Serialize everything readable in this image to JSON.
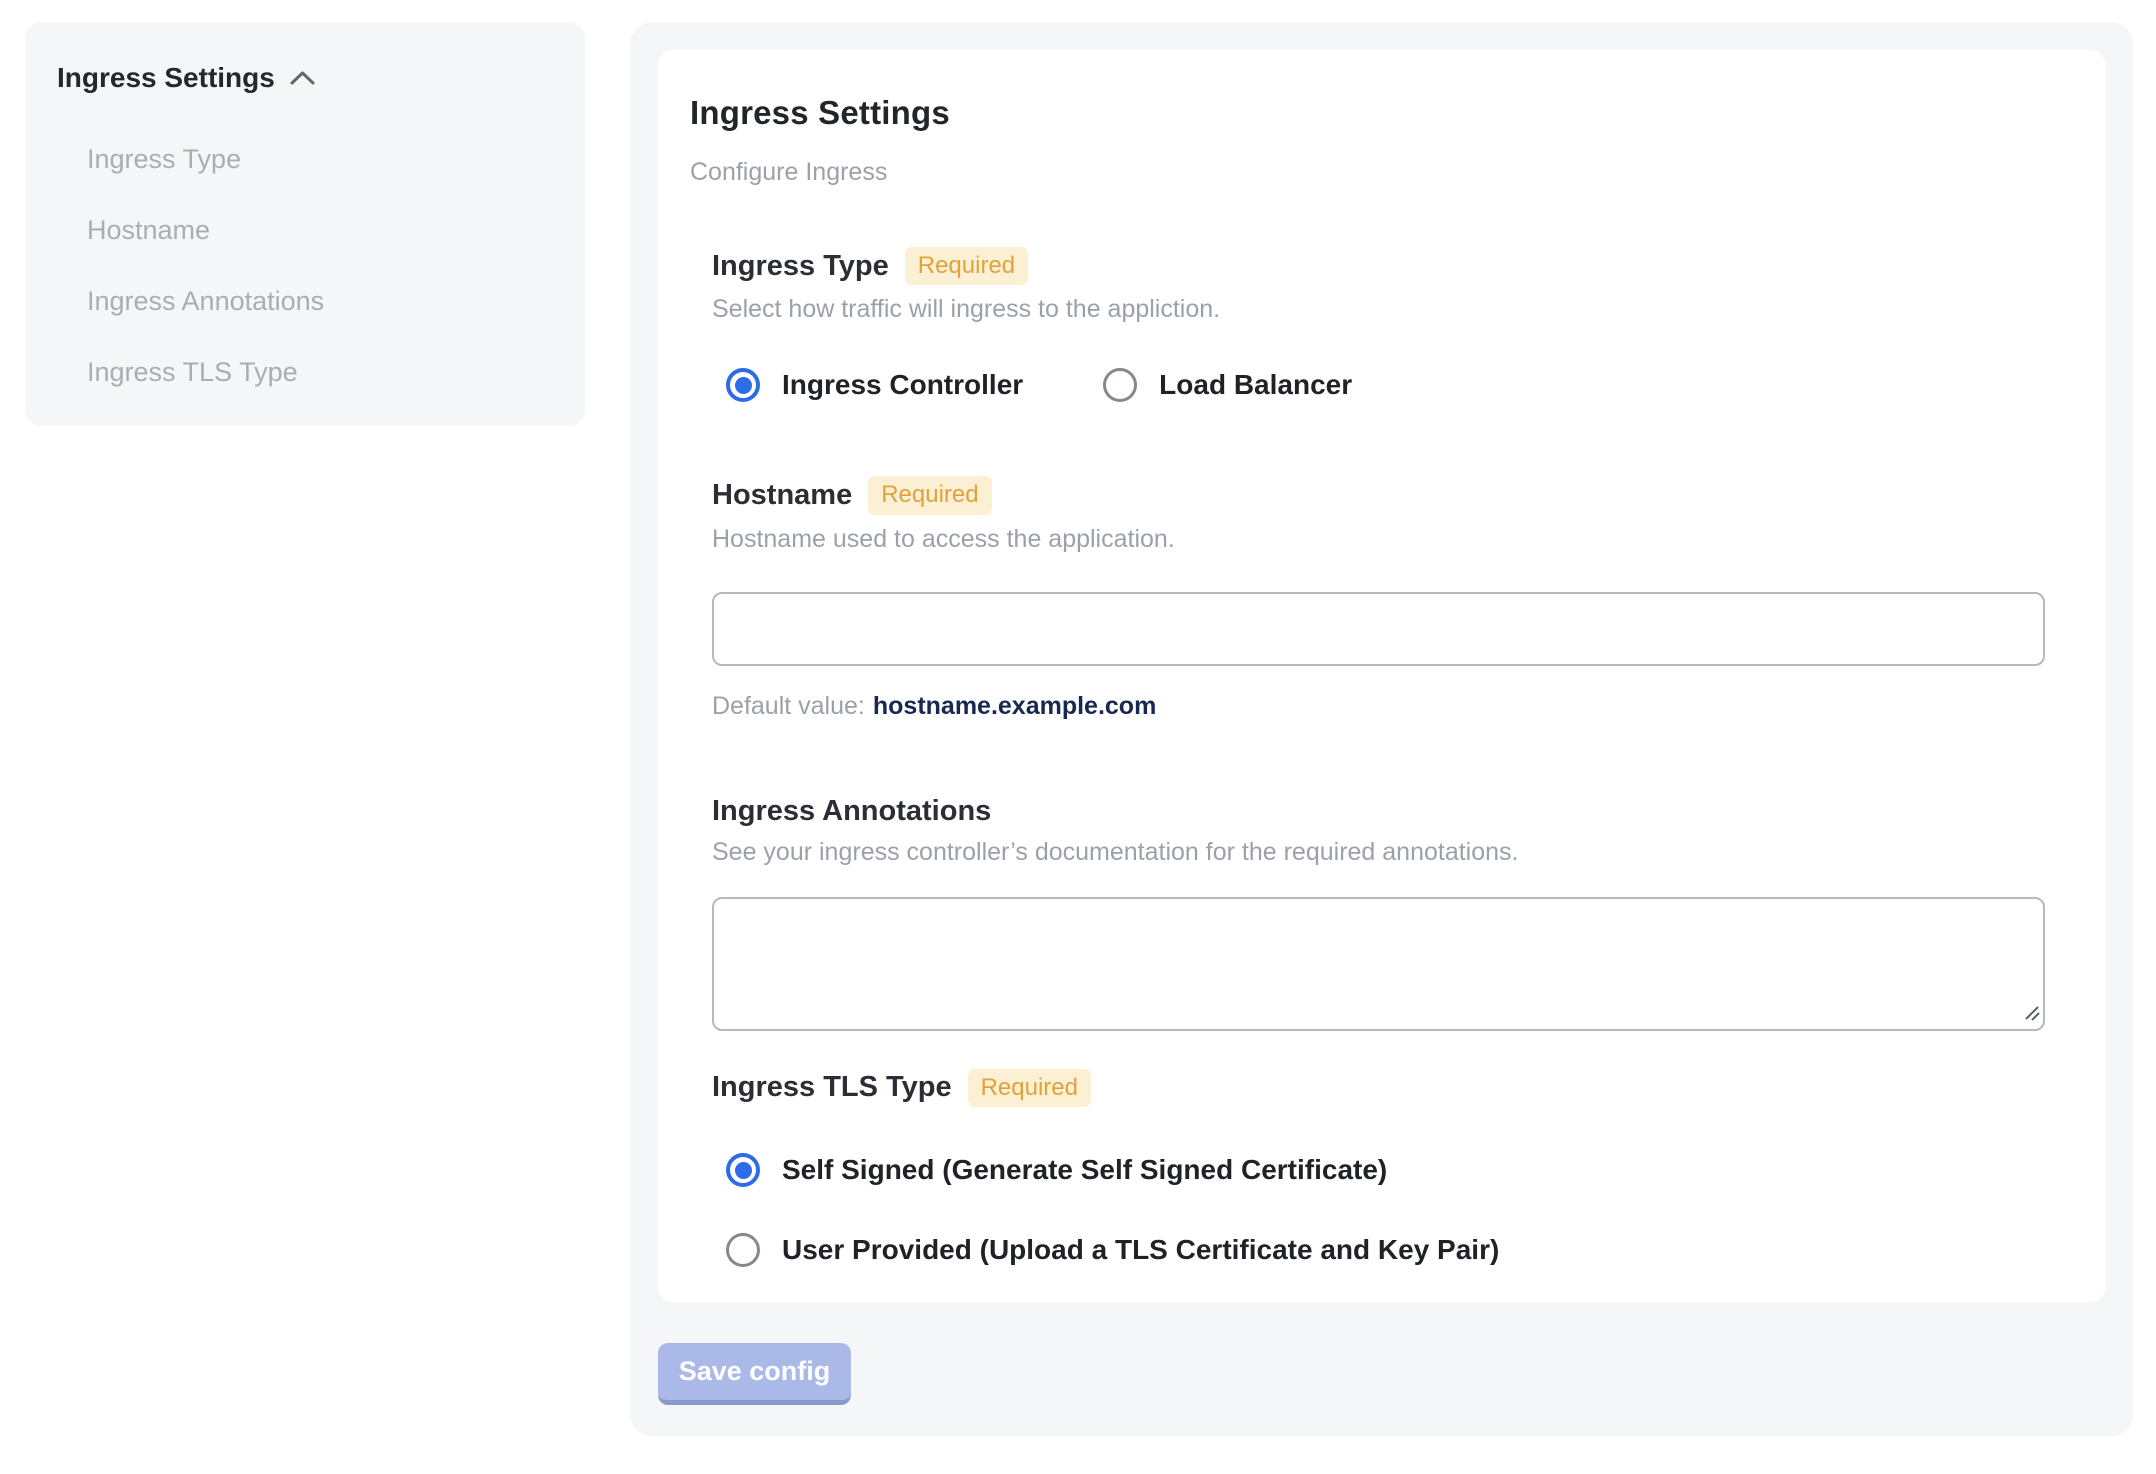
{
  "colors": {
    "panel_bg": "#f5f6f8",
    "accent_blue": "#2c6ce8",
    "badge_bg": "#fbf0d3",
    "badge_text": "#e2a23b",
    "save_button_bg": "#abb9e9",
    "default_value_text": "#182851"
  },
  "sidebar": {
    "header": "Ingress Settings",
    "collapse_icon": "chevron-up-icon",
    "items": [
      {
        "label": "Ingress Type"
      },
      {
        "label": "Hostname"
      },
      {
        "label": "Ingress Annotations"
      },
      {
        "label": "Ingress TLS Type"
      }
    ]
  },
  "main": {
    "title": "Ingress Settings",
    "subtitle": "Configure Ingress",
    "required_label": "Required",
    "sections": {
      "ingress_type": {
        "label": "Ingress Type",
        "required": true,
        "description": "Select how traffic will ingress to the appliction.",
        "options": [
          {
            "label": "Ingress Controller",
            "selected": true
          },
          {
            "label": "Load Balancer",
            "selected": false
          }
        ]
      },
      "hostname": {
        "label": "Hostname",
        "required": true,
        "description": "Hostname used to access the application.",
        "input_value": "",
        "default_value_label": "Default value:",
        "default_value": "hostname.example.com"
      },
      "annotations": {
        "label": "Ingress Annotations",
        "required": false,
        "description": "See your ingress controller’s documentation for the required annotations.",
        "textarea_value": ""
      },
      "tls_type": {
        "label": "Ingress TLS Type",
        "required": true,
        "options": [
          {
            "label": "Self Signed (Generate Self Signed Certificate)",
            "selected": true
          },
          {
            "label": "User Provided (Upload a TLS Certificate and Key Pair)",
            "selected": false
          }
        ]
      }
    },
    "save_button": "Save config"
  }
}
